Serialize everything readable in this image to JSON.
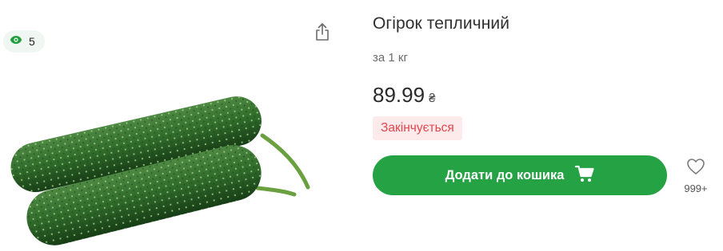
{
  "views": {
    "count": "5",
    "icon": "eye-icon",
    "color": "#1f9d3f"
  },
  "share": {
    "icon": "share-icon"
  },
  "product": {
    "title": "Огірок тепличний",
    "unit": "за 1 кг",
    "price": "89.99",
    "currency": "₴",
    "stock_status": "Закінчується",
    "image": "cucumber-photo"
  },
  "cart": {
    "label": "Додати до кошика",
    "icon": "cart-icon",
    "color": "#25a244"
  },
  "favorite": {
    "icon": "heart-icon",
    "count": "999+"
  },
  "colors": {
    "stock_badge_bg": "#fdeaea",
    "stock_badge_text": "#e2454d"
  }
}
